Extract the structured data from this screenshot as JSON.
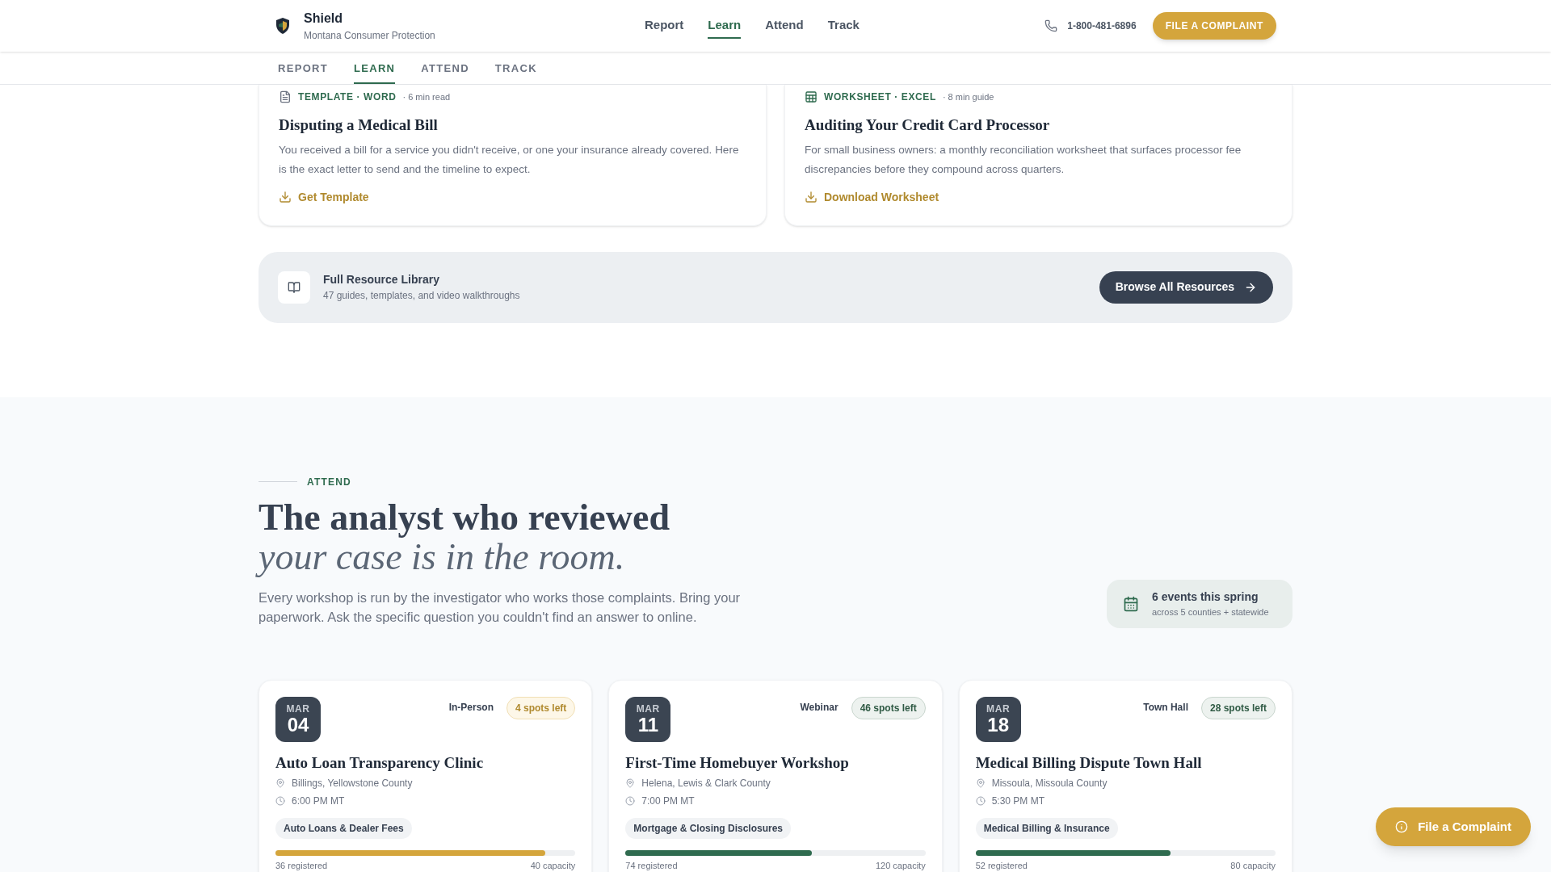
{
  "header": {
    "brand": "Shield",
    "tagline": "Montana Consumer Protection",
    "nav": [
      {
        "label": "Report",
        "selected": false
      },
      {
        "label": "Learn",
        "selected": true
      },
      {
        "label": "Attend",
        "selected": false
      },
      {
        "label": "Track",
        "selected": false
      }
    ],
    "phone": "1-800-481-6896",
    "cta": "FILE A COMPLAINT"
  },
  "subnav": [
    {
      "label": "REPORT",
      "selected": false
    },
    {
      "label": "LEARN",
      "selected": true
    },
    {
      "label": "ATTEND",
      "selected": false
    },
    {
      "label": "TRACK",
      "selected": false
    }
  ],
  "resources": [
    {
      "kind": "template",
      "type": "TEMPLATE · WORD",
      "duration": "· 6 min read",
      "title": "Disputing a Medical Bill",
      "description": "You received a bill for a service you didn't receive, or one your insurance already covered. Here is the exact letter to send and the timeline to expect.",
      "link": "Get Template"
    },
    {
      "kind": "worksheet",
      "type": "WORKSHEET · EXCEL",
      "duration": "· 8 min guide",
      "title": "Auditing Your Credit Card Processor",
      "description": "For small business owners: a monthly reconciliation worksheet that surfaces processor fee discrepancies before they compound across quarters.",
      "link": "Download Worksheet"
    }
  ],
  "library": {
    "title": "Full Resource Library",
    "subtitle": "47 guides, templates, and video walkthroughs",
    "button": "Browse All Resources"
  },
  "attend": {
    "eyebrow": "ATTEND",
    "heading": "The analyst who reviewed",
    "heading_italic": "your case is in the room.",
    "intro": "Every workshop is run by the investigator who works those complaints. Bring your paperwork. Ask the specific question you couldn't find an answer to online.",
    "summary": {
      "title": "6 events this spring",
      "subtitle": "across 5 counties + statewide"
    }
  },
  "events": [
    {
      "month": "MAR",
      "day": "04",
      "format": "In-Person",
      "spots": "4 spots left",
      "low_availability": true,
      "title": "Auto Loan Transparency Clinic",
      "location": "Billings, Yellowstone County",
      "time": "6:00 PM MT",
      "topic": "Auto Loans & Dealer Fees",
      "level": 0.9,
      "registered": "36 registered",
      "capacity": "40 capacity"
    },
    {
      "month": "MAR",
      "day": "11",
      "format": "Webinar",
      "spots": "46 spots left",
      "low_availability": false,
      "title": "First-Time Homebuyer Workshop",
      "location": "Helena, Lewis & Clark County",
      "time": "7:00 PM MT",
      "topic": "Mortgage & Closing Disclosures",
      "level": 0.62,
      "registered": "74 registered",
      "capacity": "120 capacity"
    },
    {
      "month": "MAR",
      "day": "18",
      "format": "Town Hall",
      "spots": "28 spots left",
      "low_availability": false,
      "title": "Medical Billing Dispute Town Hall",
      "location": "Missoula, Missoula County",
      "time": "5:30 PM MT",
      "topic": "Medical Billing & Insurance",
      "level": 0.65,
      "registered": "52 registered",
      "capacity": "80 capacity"
    }
  ],
  "floating_button": "File a Complaint"
}
